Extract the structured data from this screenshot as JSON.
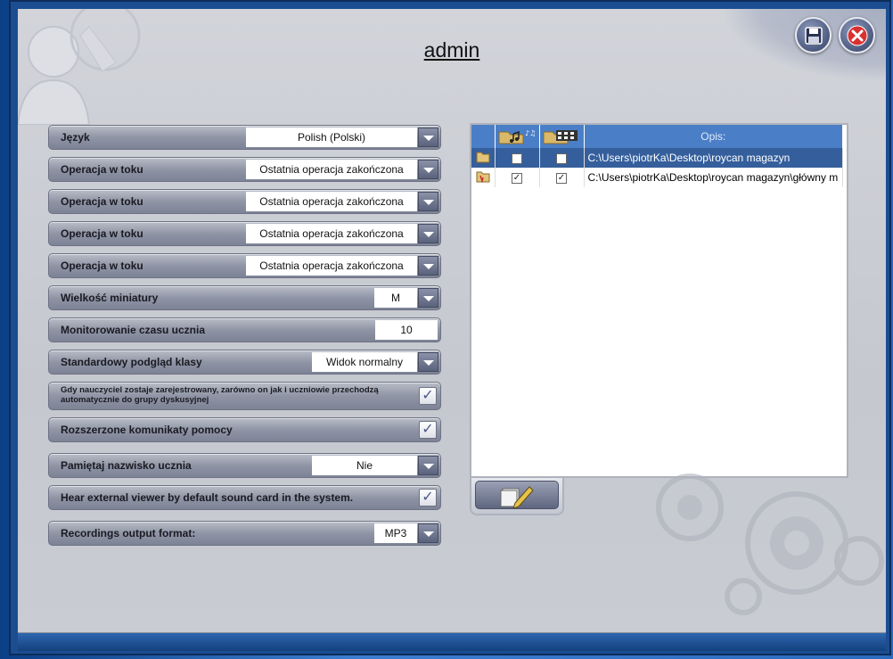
{
  "window": {
    "title": "admin"
  },
  "settings": [
    {
      "label": "Język",
      "value": "Polish (Polski)",
      "type": "dropdown"
    },
    {
      "label": "Operacja w toku",
      "value": "Ostatnia operacja zakończona",
      "type": "dropdown"
    },
    {
      "label": "Operacja w toku",
      "value": "Ostatnia operacja zakończona",
      "type": "dropdown"
    },
    {
      "label": "Operacja w toku",
      "value": "Ostatnia operacja zakończona",
      "type": "dropdown"
    },
    {
      "label": "Operacja w toku",
      "value": "Ostatnia operacja zakończona",
      "type": "dropdown"
    },
    {
      "label": "Wielkość miniatury",
      "value": "M",
      "type": "dropdown"
    },
    {
      "label": "Monitorowanie czasu ucznia",
      "value": "10",
      "type": "text"
    },
    {
      "label": "Standardowy podgląd klasy",
      "value": "Widok normalny",
      "type": "dropdown"
    },
    {
      "label": "Gdy nauczyciel zostaje zarejestrowany, zarówno on jak i uczniowie przechodzą automatycznie do grupy dyskusyjnej",
      "checked": true,
      "type": "checkbox"
    },
    {
      "label": "Rozszerzone komunikaty pomocy",
      "checked": true,
      "type": "checkbox"
    },
    {
      "label": "Pamiętaj nazwisko ucznia",
      "value": "Nie",
      "type": "dropdown"
    },
    {
      "label": "Hear external viewer by default sound card in the system.",
      "checked": true,
      "type": "checkbox"
    },
    {
      "label": "Recordings output format:",
      "value": "MP3",
      "type": "dropdown"
    }
  ],
  "folders": {
    "header_opis": "Opis:",
    "rows": [
      {
        "audio": false,
        "video": false,
        "path": "C:\\Users\\piotrKa\\Desktop\\roycan magazyn",
        "selected": true
      },
      {
        "audio": true,
        "video": true,
        "path": "C:\\Users\\piotrKa\\Desktop\\roycan magazyn\\główny m",
        "selected": false
      }
    ]
  },
  "colors": {
    "accent": "#4a7fc7",
    "selected_row": "#355f9c",
    "close": "#d93030"
  }
}
